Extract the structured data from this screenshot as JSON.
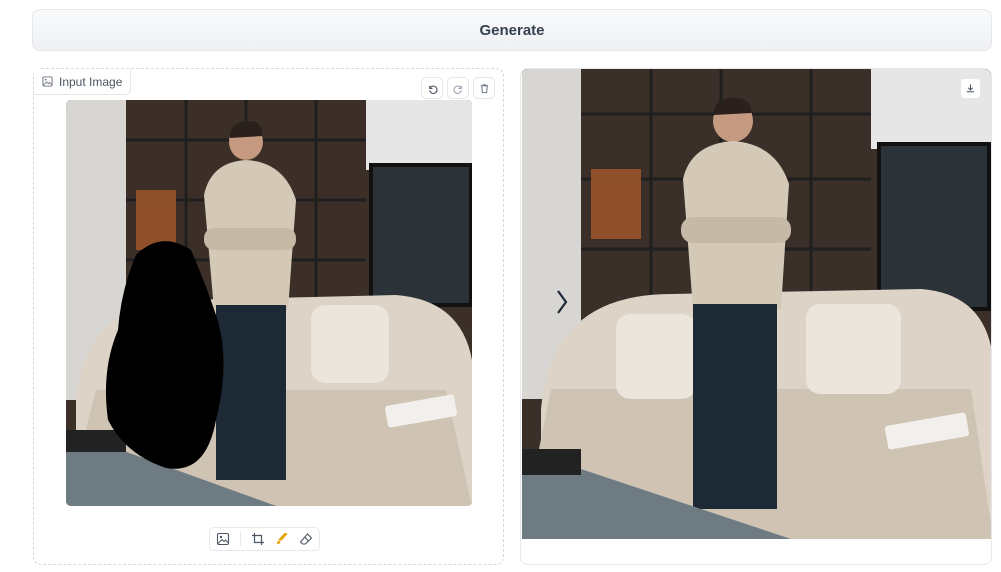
{
  "generate_button": {
    "label": "Generate"
  },
  "input_panel": {
    "label": "Input Image",
    "label_icon": "image-icon",
    "toolbar_top": [
      "undo-icon",
      "redo-icon",
      "trash-icon"
    ],
    "toolbar_bottom": [
      "image-icon",
      "crop-icon",
      "brush-icon",
      "eraser-icon"
    ]
  },
  "output_panel": {
    "download_icon": "download-icon",
    "compare_handle_icon": "chevron-right-icon"
  },
  "colors": {
    "border": "#e5e7eb",
    "text": "#374151",
    "button_bg": "#f3f4f6"
  }
}
